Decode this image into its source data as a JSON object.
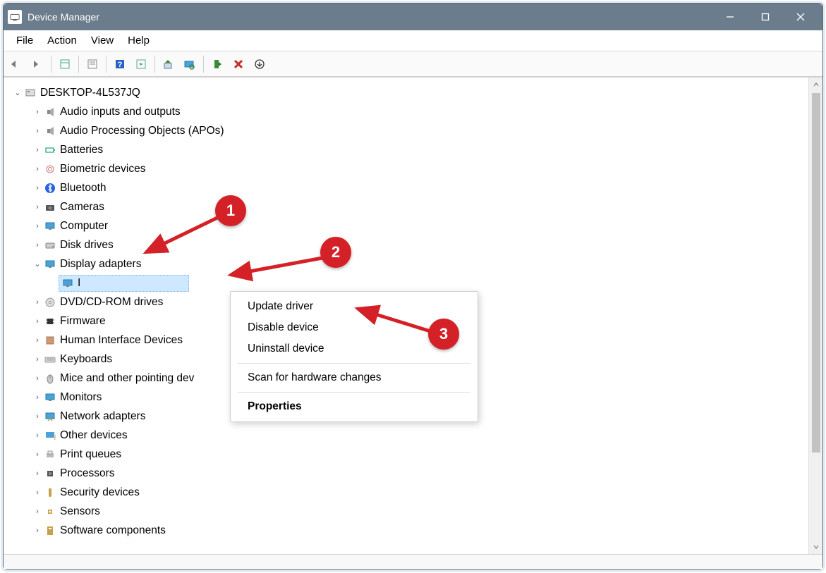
{
  "window": {
    "title": "Device Manager"
  },
  "menus": {
    "file": "File",
    "action": "Action",
    "view": "View",
    "help": "Help"
  },
  "tree": {
    "root": "DESKTOP-4L537JQ",
    "items": [
      {
        "label": "Audio inputs and outputs",
        "icon": "speaker"
      },
      {
        "label": "Audio Processing Objects (APOs)",
        "icon": "speaker"
      },
      {
        "label": "Batteries",
        "icon": "battery"
      },
      {
        "label": "Biometric devices",
        "icon": "fingerprint"
      },
      {
        "label": "Bluetooth",
        "icon": "bluetooth"
      },
      {
        "label": "Cameras",
        "icon": "camera"
      },
      {
        "label": "Computer",
        "icon": "monitor"
      },
      {
        "label": "Disk drives",
        "icon": "drive"
      },
      {
        "label": "Display adapters",
        "icon": "monitor",
        "expanded": true,
        "children": [
          {
            "label": "I",
            "icon": "gpu",
            "selected": true
          }
        ]
      },
      {
        "label": "DVD/CD-ROM drives",
        "icon": "disc"
      },
      {
        "label": "Firmware",
        "icon": "chip"
      },
      {
        "label": "Human Interface Devices",
        "icon": "hid"
      },
      {
        "label": "Keyboards",
        "icon": "keyboard"
      },
      {
        "label": "Mice and other pointing dev",
        "icon": "mouse"
      },
      {
        "label": "Monitors",
        "icon": "monitor"
      },
      {
        "label": "Network adapters",
        "icon": "network"
      },
      {
        "label": "Other devices",
        "icon": "question"
      },
      {
        "label": "Print queues",
        "icon": "printer"
      },
      {
        "label": "Processors",
        "icon": "cpu"
      },
      {
        "label": "Security devices",
        "icon": "shield"
      },
      {
        "label": "Sensors",
        "icon": "sensor"
      },
      {
        "label": "Software components",
        "icon": "component"
      }
    ]
  },
  "context_menu": {
    "update": "Update driver",
    "disable": "Disable device",
    "uninstall": "Uninstall device",
    "scan": "Scan for hardware changes",
    "properties": "Properties"
  },
  "callouts": {
    "c1": "1",
    "c2": "2",
    "c3": "3"
  }
}
